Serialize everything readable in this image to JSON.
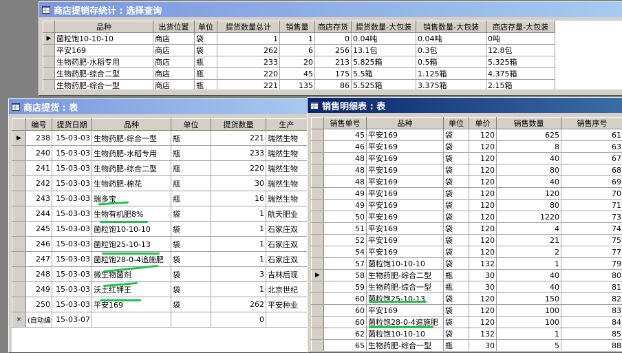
{
  "win1": {
    "title": "商店提销存统计 : 选择查询",
    "columns": [
      "品种",
      "出货位置",
      "单位",
      "提货数量总计",
      "销售量",
      "商店存货",
      "提货数量-大包装",
      "销售数量-大包装",
      "商店存量-大包装"
    ],
    "rows": [
      [
        "菌粒饱10-10-10",
        "商店",
        "袋",
        "1",
        "1",
        "0",
        "0.04吨",
        "0.04吨",
        "0吨"
      ],
      [
        "平安169",
        "商店",
        "袋",
        "262",
        "6",
        "256",
        "13.1包",
        "0.3包",
        "12.8包"
      ],
      [
        "生物药肥-水稻专用",
        "商店",
        "瓶",
        "233",
        "20",
        "213",
        "5.825箱",
        "0.5箱",
        "5.325箱"
      ],
      [
        "生物药肥-综合二型",
        "商店",
        "瓶",
        "220",
        "45",
        "175",
        "5.5箱",
        "1.125箱",
        "4.375箱"
      ],
      [
        "生物药肥-综合一型",
        "商店",
        "瓶",
        "221",
        "135",
        "86",
        "5.525箱",
        "3.375箱",
        "2.15箱"
      ]
    ]
  },
  "win2": {
    "title": "商店提货 : 表",
    "columns": [
      "编号",
      "提货日期",
      "品种",
      "单位",
      "提货数量",
      "生产"
    ],
    "rows": [
      [
        "238",
        "15-03-03",
        "生物药肥-综合一型",
        "瓶",
        "221",
        "瑞然生物"
      ],
      [
        "240",
        "15-03-03",
        "生物药肥-水稻专用",
        "瓶",
        "233",
        "瑞然生物"
      ],
      [
        "241",
        "15-03-03",
        "生物药肥-综合二型",
        "瓶",
        "220",
        "瑞然生物"
      ],
      [
        "242",
        "15-03-03",
        "生物药肥-棉花",
        "瓶",
        "30",
        "瑞然生物"
      ],
      [
        "243",
        "15-03-03",
        "瑞多宝",
        "瓶",
        "16",
        "瑞然生物"
      ],
      [
        "244",
        "15-03-03",
        "生物有机肥8%",
        "袋",
        "1",
        "航天肥业"
      ],
      [
        "245",
        "15-03-03",
        "菌粒饱10-10-10",
        "袋",
        "1",
        "石家庄双"
      ],
      [
        "246",
        "15-03-03",
        "菌粒饱25-10-13",
        "袋",
        "1",
        "石家庄双"
      ],
      [
        "247",
        "15-03-03",
        "菌粒饱28-0-4追施肥",
        "袋",
        "1",
        "石家庄双"
      ],
      [
        "248",
        "15-03-03",
        "微生物菌剂",
        "袋",
        "3",
        "吉林后现"
      ],
      [
        "249",
        "15-03-03",
        "沃土红钾王",
        "袋",
        "1",
        "北京世纪"
      ],
      [
        "250",
        "15-03-03",
        "平安169",
        "袋",
        "262",
        "平安种业"
      ]
    ],
    "new_row": [
      "(自动编号)",
      "15-03-07",
      "",
      "",
      "0",
      ""
    ]
  },
  "win3": {
    "title": "销售明细表 : 表",
    "columns": [
      "销售单号",
      "品种",
      "单位",
      "单价",
      "销售数量",
      "销售序号"
    ],
    "rows": [
      [
        "45",
        "平安169",
        "袋",
        "120",
        "625",
        "61"
      ],
      [
        "46",
        "平安169",
        "袋",
        "120",
        "8",
        "63"
      ],
      [
        "48",
        "平安169",
        "袋",
        "120",
        "40",
        "67"
      ],
      [
        "48",
        "平安169",
        "袋",
        "120",
        "80",
        "68"
      ],
      [
        "48",
        "平安169",
        "袋",
        "120",
        "40",
        "69"
      ],
      [
        "49",
        "平安169",
        "袋",
        "120",
        "120",
        "70"
      ],
      [
        "49",
        "平安169",
        "袋",
        "120",
        "80",
        "71"
      ],
      [
        "50",
        "平安169",
        "袋",
        "120",
        "1220",
        "73"
      ],
      [
        "51",
        "平安169",
        "袋",
        "120",
        "4",
        "74"
      ],
      [
        "52",
        "平安169",
        "袋",
        "120",
        "21",
        "75"
      ],
      [
        "54",
        "平安169",
        "袋",
        "120",
        "2",
        "77"
      ],
      [
        "57",
        "菌粒饱10-10-10",
        "袋",
        "132",
        "1",
        "79"
      ],
      [
        "58",
        "生物药肥-综合二型",
        "瓶",
        "30",
        "40",
        "80"
      ],
      [
        "59",
        "生物药肥-综合一型",
        "瓶",
        "30",
        "40",
        "81"
      ],
      [
        "60",
        "菌粒饱25-10-13",
        "袋",
        "120",
        "150",
        "82"
      ],
      [
        "60",
        "平安169",
        "袋",
        "120",
        "100",
        "83"
      ],
      [
        "60",
        "菌粒饱28-0-4追施肥",
        "袋",
        "120",
        "100",
        "84"
      ],
      [
        "62",
        "菌粒饱10-10-10",
        "袋",
        "132",
        "1",
        "85"
      ],
      [
        "65",
        "生物药肥-综合一型",
        "瓶",
        "30",
        "5",
        "88"
      ]
    ]
  },
  "colors": {
    "underline": "#1fc24c",
    "active_title": "#0a246a",
    "inactive_title": "#7a96df"
  }
}
